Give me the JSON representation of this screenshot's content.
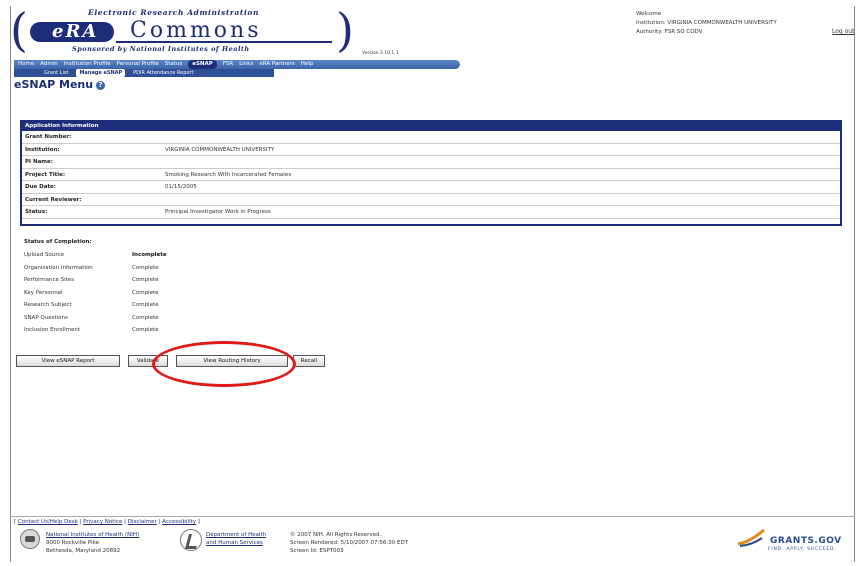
{
  "header": {
    "logo_top": "Electronic Research Administration",
    "logo_era": "eRA",
    "logo_commons": "Commons",
    "logo_bottom": "Sponsored by National Institutes of Health",
    "version": "Version 2.10.1.1",
    "user": {
      "welcome": "Welcome",
      "institution": "Institution: VIRGINIA COMMONWEALTH UNIVERSITY",
      "authority": "Authority:  FSR  SO  CODV",
      "logout": "Log out"
    }
  },
  "nav": {
    "items": [
      {
        "label": "Home",
        "active": false
      },
      {
        "label": "Admin",
        "active": false
      },
      {
        "label": "Institution Profile",
        "active": false
      },
      {
        "label": "Personal Profile",
        "active": false
      },
      {
        "label": "Status",
        "active": false
      },
      {
        "label": "eSNAP",
        "active": true
      },
      {
        "label": "FSR",
        "active": false
      },
      {
        "label": "Links",
        "active": false
      },
      {
        "label": "eRA Partners",
        "active": false
      },
      {
        "label": "Help",
        "active": false
      }
    ],
    "subitems": [
      {
        "label": "Grant List",
        "active": false
      },
      {
        "label": "Manage eSNAP",
        "active": true
      },
      {
        "label": "PDIR Attendance Report",
        "active": false
      }
    ]
  },
  "page_title": "eSNAP Menu",
  "app_info": {
    "header": "Application Information",
    "rows": [
      {
        "label": "Grant Number:",
        "value": ""
      },
      {
        "label": "Institution:",
        "value": "VIRGINIA COMMONWEALTH UNIVERSITY"
      },
      {
        "label": "PI Name:",
        "value": ""
      },
      {
        "label": "Project Title:",
        "value": "Smoking Research With Incarcerated Females"
      },
      {
        "label": "Due Date:",
        "value": "01/15/2005"
      },
      {
        "label": "Current Reviewer:",
        "value": ""
      },
      {
        "label": "Status:",
        "value": "Principal Investigator Work in Progress"
      }
    ]
  },
  "completion": {
    "title": "Status of Completion:",
    "rows": [
      {
        "name": "Upload Source",
        "status": "Incomplete",
        "bold": true
      },
      {
        "name": "Organization Information",
        "status": "Complete",
        "bold": false
      },
      {
        "name": "Performance Sites",
        "status": "Complete",
        "bold": false
      },
      {
        "name": "Key Personnel",
        "status": "Complete",
        "bold": false
      },
      {
        "name": "Research Subject",
        "status": "Complete",
        "bold": false
      },
      {
        "name": "SNAP Questions",
        "status": "Complete",
        "bold": false
      },
      {
        "name": "Inclusion Enrollment",
        "status": "Complete",
        "bold": false
      }
    ]
  },
  "buttons": {
    "view_report": "View eSNAP Report",
    "validate": "Validate",
    "view_routing": "View Routing History",
    "recall": "Recall"
  },
  "footer": {
    "links": [
      "Contact Us/Help Desk",
      "Privacy Notice",
      "Disclaimer",
      "Accessibility"
    ],
    "nih_name": "National Institutes of Health (NIH)",
    "nih_addr1": "9000 Rockville Pike",
    "nih_addr2": "Bethesda, Maryland 20892",
    "hhs_line1": "Department of Health",
    "hhs_line2": "and Human Services",
    "copyright": "© 2007 NIH. All Rights Reserved.",
    "rendered": "Screen Rendered: 5/10/2007 07:56:30 EDT",
    "screen_id": "Screen Id: ESPT003",
    "grants_name": "GRANTS.GOV",
    "grants_tag": "FIND. APPLY. SUCCEED."
  },
  "colors": {
    "brand_navy": "#1d2d7a",
    "nav_blue": "#3c64a8",
    "highlight_red": "#e01b1b"
  }
}
